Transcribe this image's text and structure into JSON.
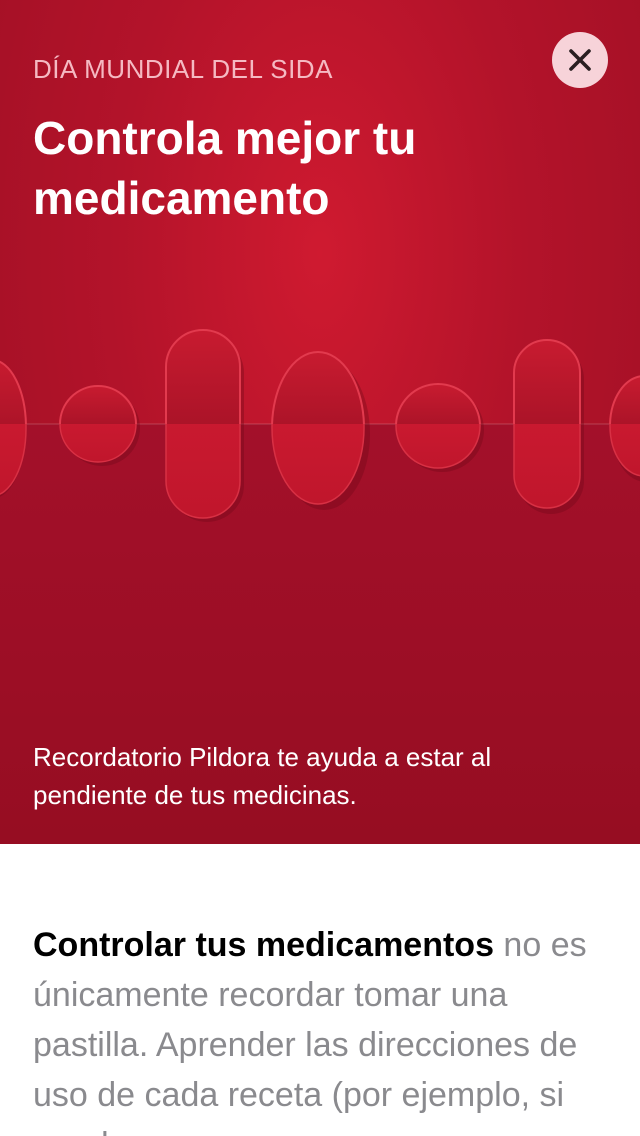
{
  "hero": {
    "eyebrow": "DÍA MUNDIAL DEL SIDA",
    "title": "Controla mejor tu medicamento",
    "caption": "Recordatorio Pildora te ayuda a estar al pendiente de tus medicinas.",
    "close_icon": "close-icon",
    "colors": {
      "background": "#b3132a",
      "eyebrow": "#f5b9c2",
      "close_button": "#f7d3d9"
    }
  },
  "article": {
    "lead": "Controlar tus medicamentos",
    "body": " no es únicamente recordar tomar una pastilla. Aprender las direcciones de uso de cada receta (por ejemplo, si puedes"
  }
}
